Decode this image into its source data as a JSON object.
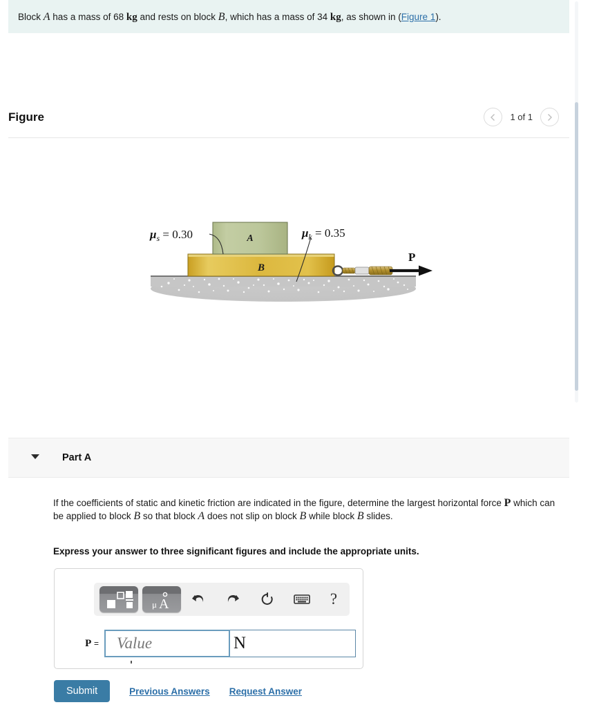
{
  "statement": {
    "prefix": "Block ",
    "var_a": "A",
    "mid1": " has a mass of 68 ",
    "unit1": "kg",
    "mid2": " and rests on block ",
    "var_b": "B",
    "mid3": ", which has a mass of 34 ",
    "unit2": "kg",
    "mid4": ", as shown in (",
    "figure_link": "Figure 1",
    "suffix": ")."
  },
  "figure": {
    "title": "Figure",
    "count_label": "1 of 1",
    "prev_icon": "chevron-left-icon",
    "next_icon": "chevron-right-icon",
    "labels": {
      "mu_s": "μ",
      "mu_s_sub": "s",
      "mu_s_value": "= 0.30",
      "mu_k": "μ",
      "mu_k_sub": "k",
      "mu_k_value": "= 0.35",
      "block_a": "A",
      "block_b": "B",
      "force": "P"
    },
    "colors": {
      "block_a_fill": "#b7c293",
      "block_a_edge": "#6f7a52",
      "block_b_fill": "#d2ae33",
      "block_b_edge": "#8a6f17",
      "ground": "#c6c6c6",
      "rope": "#b89a4e"
    }
  },
  "part": {
    "label": "Part A",
    "caret_icon": "caret-down-icon",
    "question": "If the coefficients of static and kinetic friction are indicated in the figure, determine the largest horizontal force P which can be applied to block B so that block A does not slip on block B while block B slides.",
    "question_segments": {
      "s1": "If the coefficients of static and kinetic friction are indicated in the figure, determine the largest horizontal force ",
      "v1": "P",
      "s2": " which can be applied to block ",
      "v2": "B",
      "s3": " so that block ",
      "v3": "A",
      "s4": " does not slip on block ",
      "v4": "B",
      "s5": " while block ",
      "v5": "B",
      "s6": " slides."
    },
    "emphasis": "Express your answer to three significant figures and include the appropriate units."
  },
  "answer": {
    "toolbar": {
      "template_icon": "math-template-icon",
      "units_icon": "units-icon",
      "units_icon_text": "μÅ",
      "undo_icon": "undo-icon",
      "redo_icon": "redo-icon",
      "reset_icon": "reset-icon",
      "keyboard_icon": "keyboard-icon",
      "help_icon": "help-question-icon",
      "help_label": "?"
    },
    "variable_label": "P",
    "equals": "=",
    "value_placeholder": "Value",
    "unit_value": "N"
  },
  "footer": {
    "submit_label": "Submit",
    "previous_answers_label": "Previous Answers",
    "request_answer_label": "Request Answer",
    "submit_color": "#3a7ca5",
    "link_color": "#2c6fa8"
  }
}
